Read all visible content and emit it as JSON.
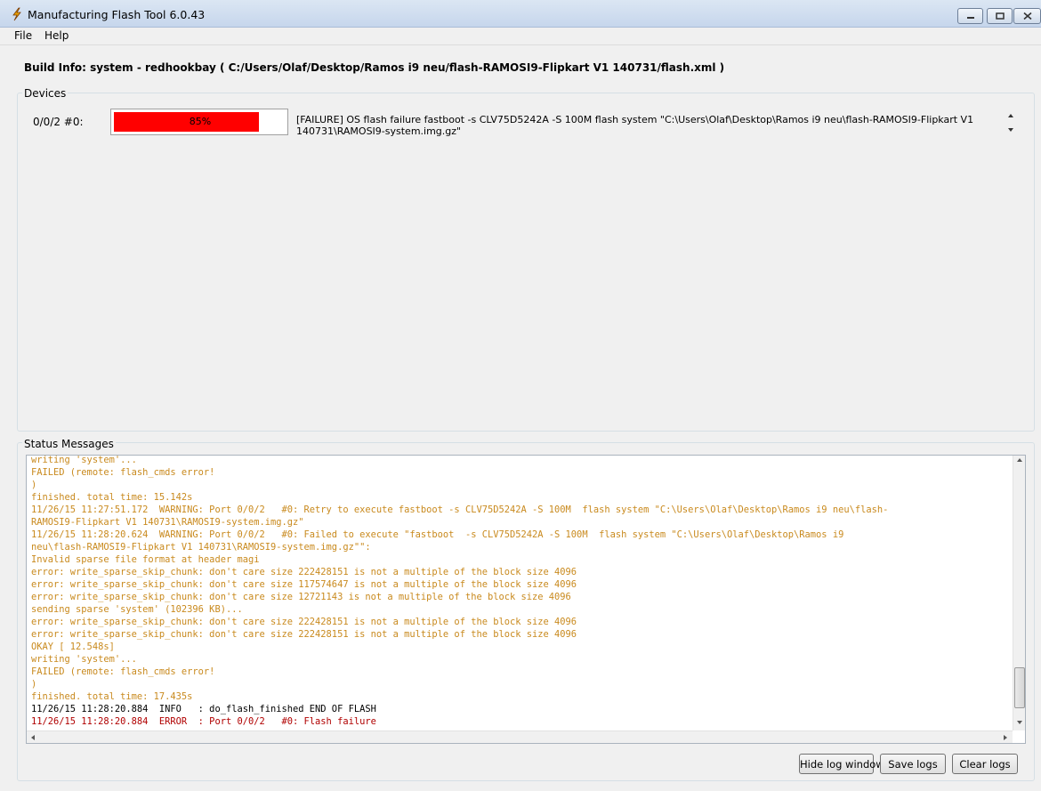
{
  "window": {
    "title": "Manufacturing Flash Tool 6.0.43"
  },
  "menu": {
    "items": [
      "File",
      "Help"
    ]
  },
  "build_info": {
    "label": "Build Info:",
    "value": "system - redhookbay ( C:/Users/Olaf/Desktop/Ramos i9 neu/flash-RAMOSI9-Flipkart V1 140731/flash.xml )"
  },
  "devices": {
    "group_label": "Devices",
    "device": {
      "port_label": "0/0/2  #0:",
      "progress_text": "85%",
      "progress_value": 0.85,
      "progress_color": "#ff0000",
      "message": "[FAILURE] OS flash failure fastboot -s CLV75D5242A -S 100M  flash system \"C:\\Users\\Olaf\\Desktop\\Ramos i9 neu\\flash-RAMOSI9-Flipkart V1 140731\\RAMOSI9-system.img.gz\""
    }
  },
  "status": {
    "group_label": "Status Messages",
    "log_lines": [
      {
        "text": "writing 'system'...",
        "color": "orange"
      },
      {
        "text": "FAILED (remote: flash_cmds error!",
        "color": "orange"
      },
      {
        "text": ")",
        "color": "orange"
      },
      {
        "text": "finished. total time: 15.142s",
        "color": "orange"
      },
      {
        "text": "11/26/15 11:27:51.172  WARNING: Port 0/0/2   #0: Retry to execute fastboot -s CLV75D5242A -S 100M  flash system \"C:\\Users\\Olaf\\Desktop\\Ramos i9 neu\\flash-",
        "color": "orange"
      },
      {
        "text": "RAMOSI9-Flipkart V1 140731\\RAMOSI9-system.img.gz\"",
        "color": "orange"
      },
      {
        "text": "11/26/15 11:28:20.624  WARNING: Port 0/0/2   #0: Failed to execute \"fastboot  -s CLV75D5242A -S 100M  flash system \"C:\\Users\\Olaf\\Desktop\\Ramos i9",
        "color": "orange"
      },
      {
        "text": "neu\\flash-RAMOSI9-Flipkart V1 140731\\RAMOSI9-system.img.gz\"\":",
        "color": "orange"
      },
      {
        "text": "Invalid sparse file format at header magi",
        "color": "orange"
      },
      {
        "text": "error: write_sparse_skip_chunk: don't care size 222428151 is not a multiple of the block size 4096",
        "color": "orange"
      },
      {
        "text": "error: write_sparse_skip_chunk: don't care size 117574647 is not a multiple of the block size 4096",
        "color": "orange"
      },
      {
        "text": "error: write_sparse_skip_chunk: don't care size 12721143 is not a multiple of the block size 4096",
        "color": "orange"
      },
      {
        "text": "sending sparse 'system' (102396 KB)...",
        "color": "orange"
      },
      {
        "text": "error: write_sparse_skip_chunk: don't care size 222428151 is not a multiple of the block size 4096",
        "color": "orange"
      },
      {
        "text": "error: write_sparse_skip_chunk: don't care size 222428151 is not a multiple of the block size 4096",
        "color": "orange"
      },
      {
        "text": "OKAY [ 12.548s]",
        "color": "orange"
      },
      {
        "text": "writing 'system'...",
        "color": "orange"
      },
      {
        "text": "FAILED (remote: flash_cmds error!",
        "color": "orange"
      },
      {
        "text": ")",
        "color": "orange"
      },
      {
        "text": "finished. total time: 17.435s",
        "color": "orange"
      },
      {
        "text": "11/26/15 11:28:20.884  INFO   : do_flash_finished END OF FLASH",
        "color": "black"
      },
      {
        "text": "11/26/15 11:28:20.884  ERROR  : Port 0/0/2   #0: Flash failure",
        "color": "red"
      }
    ]
  },
  "buttons": {
    "hide_log": "Hide log window",
    "save_logs": "Save logs",
    "clear_logs": "Clear logs"
  },
  "colors": {
    "log_orange": "#c98a1e",
    "log_black": "#000000",
    "log_red": "#b00000",
    "progress_fill": "#ff0000"
  },
  "icons": {
    "app": "lightning-bolt-icon",
    "minimize": "minimize-icon",
    "maximize": "maximize-icon",
    "close": "close-icon"
  }
}
